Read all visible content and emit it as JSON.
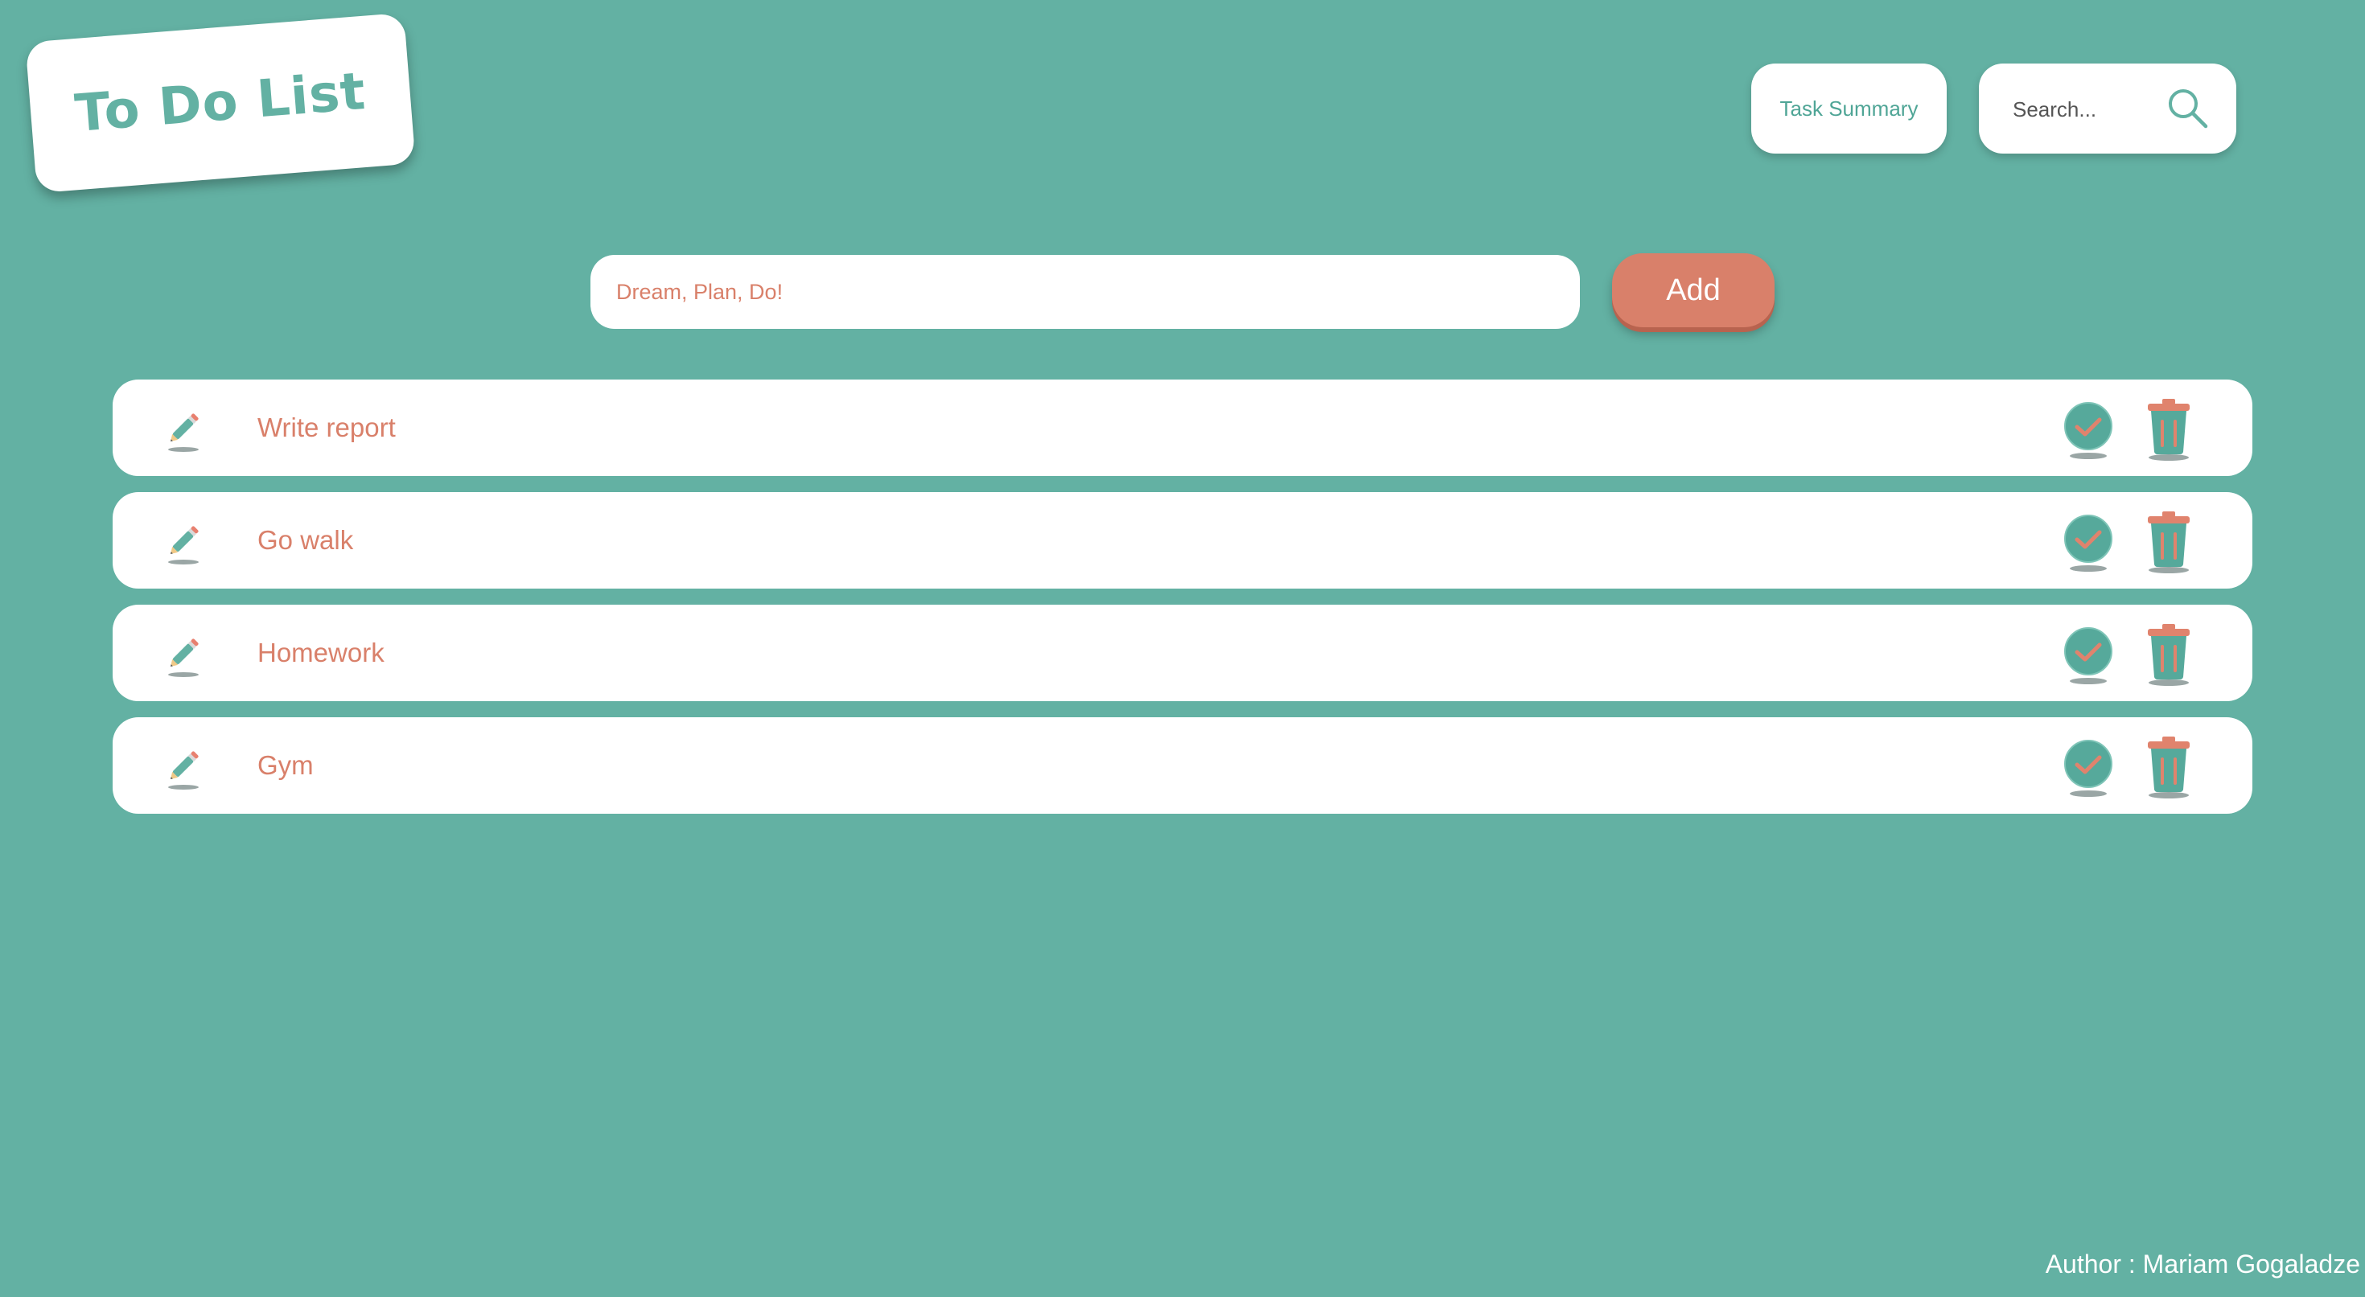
{
  "app": {
    "title": "To Do List"
  },
  "header": {
    "summary_label": "Task Summary",
    "search_placeholder": "Search...",
    "search_value": "",
    "search_icon": "search-icon"
  },
  "new_task": {
    "placeholder": "Dream, Plan, Do!",
    "value": "",
    "add_label": "Add"
  },
  "tasks": [
    {
      "label": "Write report"
    },
    {
      "label": "Go walk"
    },
    {
      "label": "Homework"
    },
    {
      "label": "Gym"
    }
  ],
  "task_icons": {
    "edit": "pencil-icon",
    "complete": "check-circle-icon",
    "delete": "trash-icon"
  },
  "footer": {
    "author": "Author : Mariam Gogaladze"
  },
  "colors": {
    "background": "#63b1a3",
    "accent": "#d9806a",
    "card": "#ffffff",
    "teal_text": "#4fa596"
  }
}
